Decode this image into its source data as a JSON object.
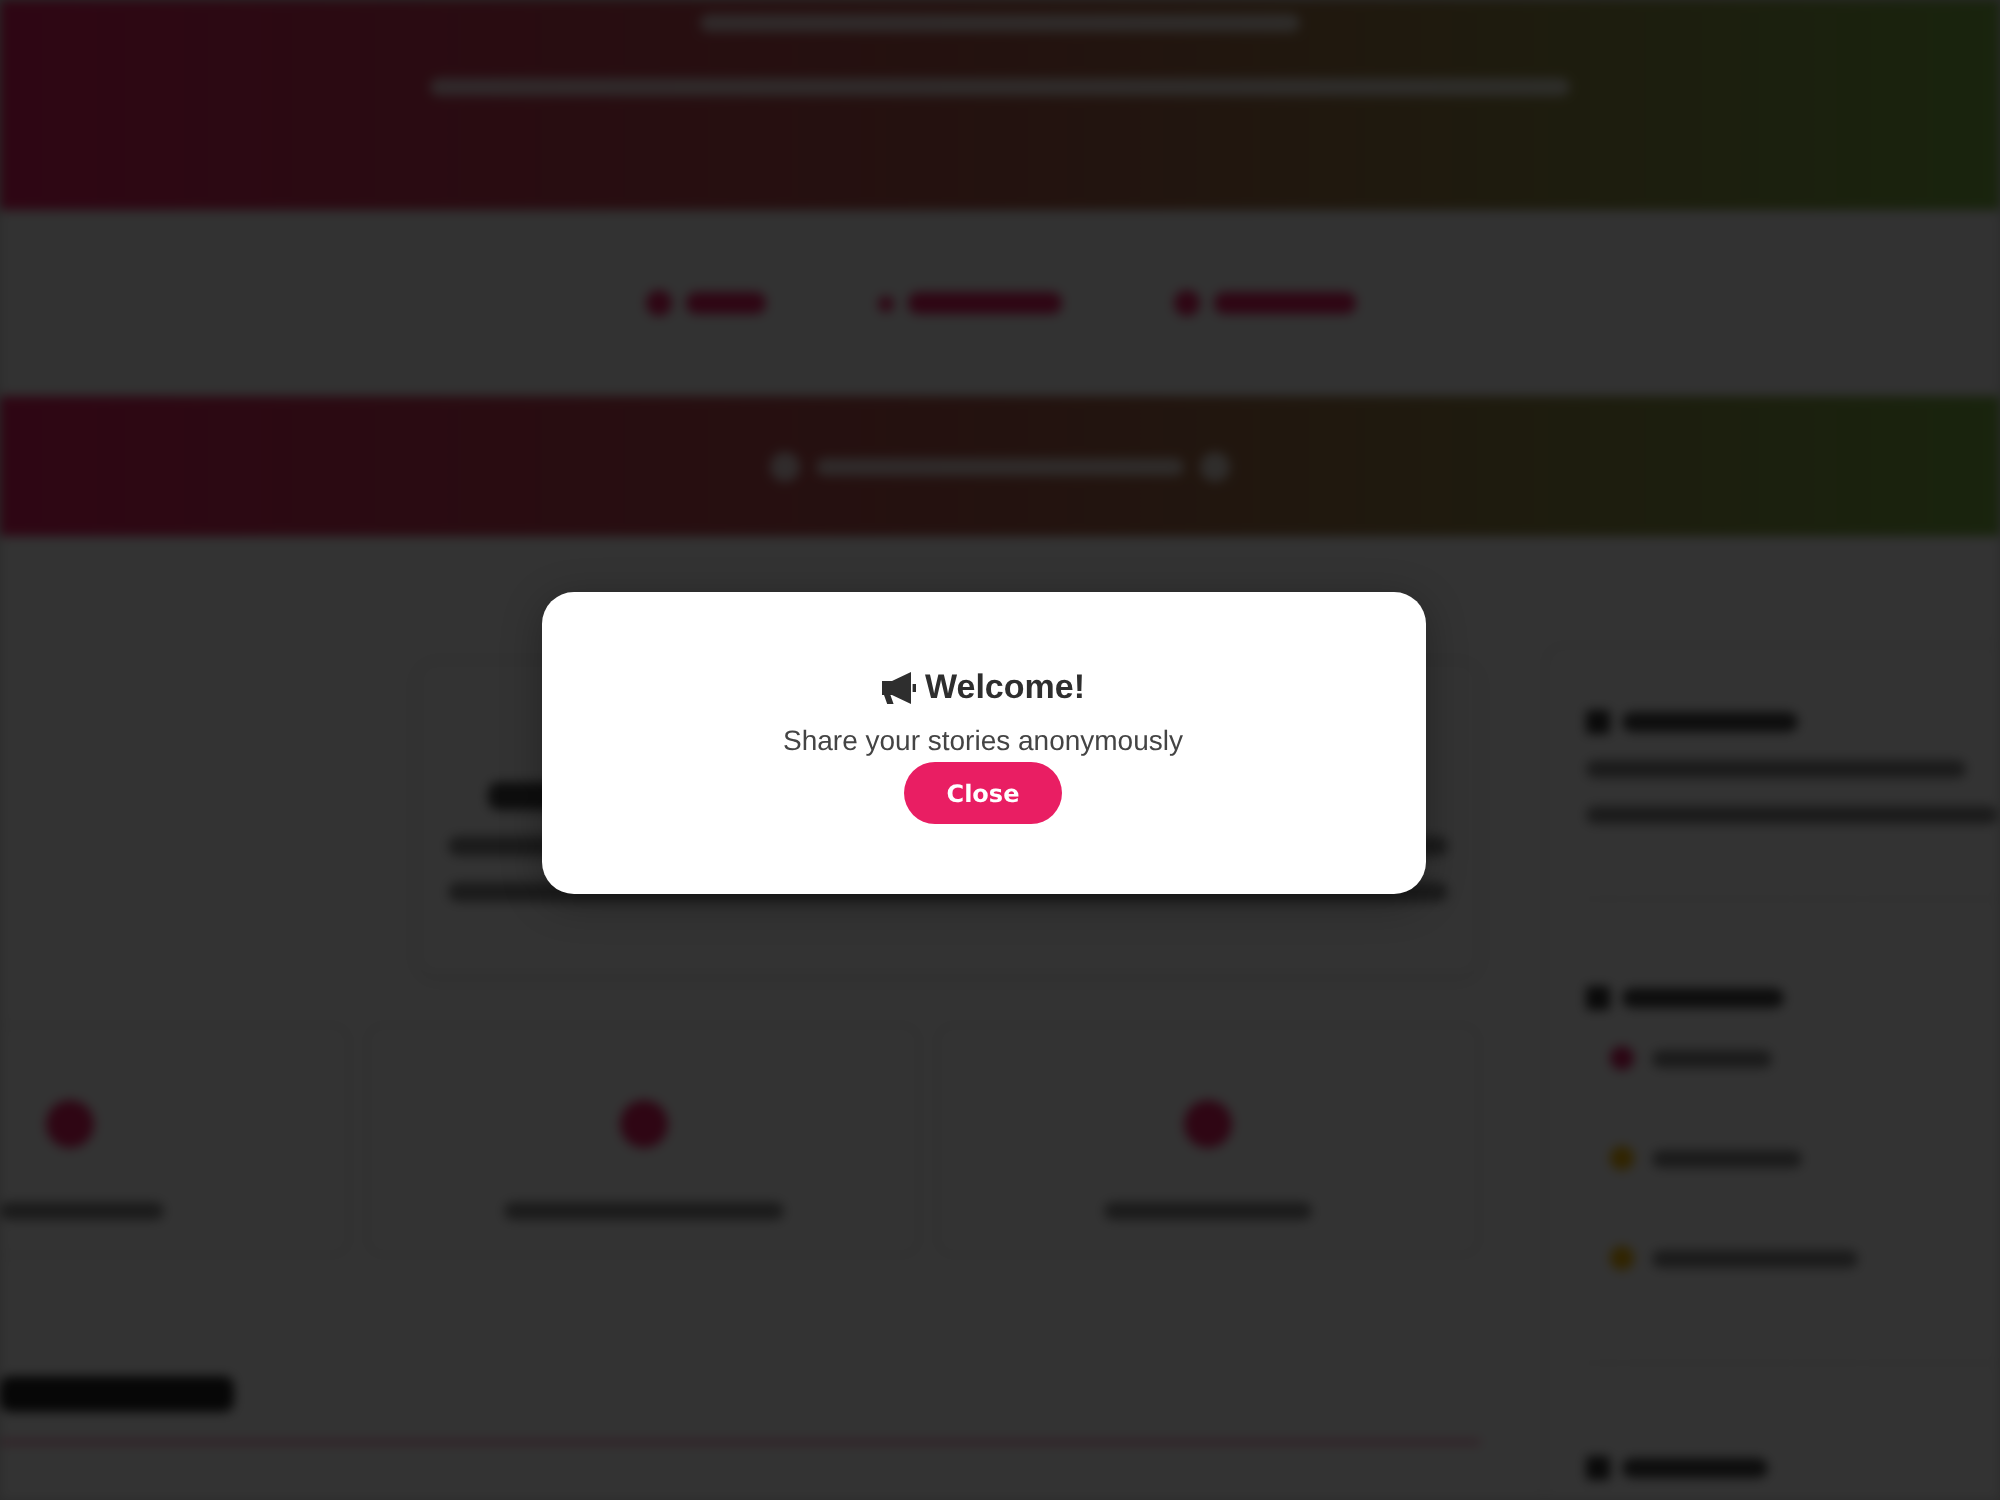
{
  "dialog": {
    "title": "Welcome!",
    "message": "Share your stories anonymously",
    "button": "Close"
  }
}
